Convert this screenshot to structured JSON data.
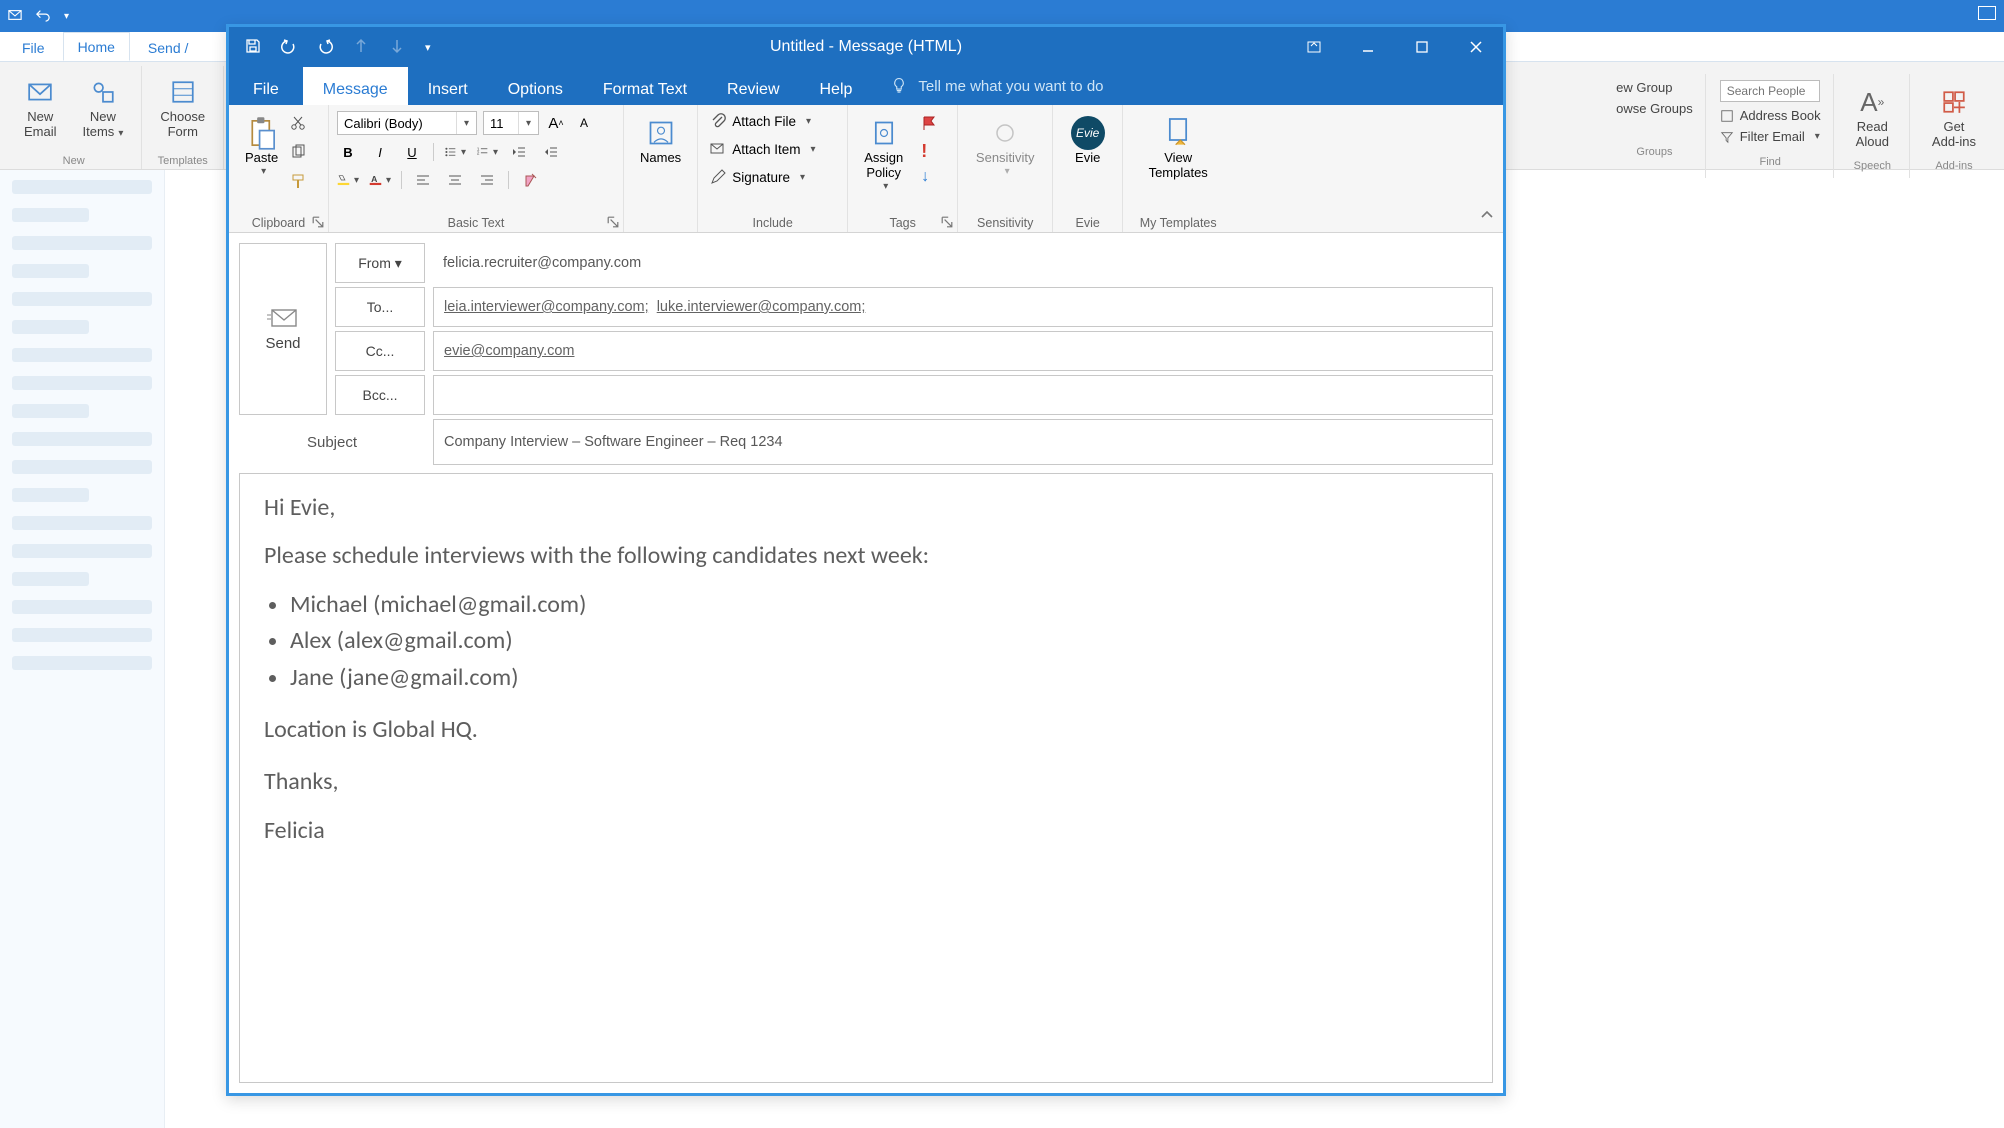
{
  "background": {
    "tabs": {
      "file": "File",
      "home": "Home",
      "send": "Send /"
    },
    "new_email": "New\nEmail",
    "new_items": "New\nItems",
    "choose_form": "Choose\nForm",
    "grp_new": "New",
    "grp_templates": "Templates",
    "right": {
      "new_group": "ew Group",
      "browse_groups": "owse Groups",
      "groups": "Groups",
      "search_placeholder": "Search People",
      "address_book": "Address Book",
      "filter_email": "Filter Email",
      "find": "Find",
      "read_aloud": "Read\nAloud",
      "speech": "Speech",
      "get_addins": "Get\nAdd-ins",
      "addins": "Add-ins"
    }
  },
  "compose": {
    "title": "Untitled  -  Message (HTML)",
    "tabs": {
      "file": "File",
      "message": "Message",
      "insert": "Insert",
      "options": "Options",
      "format": "Format Text",
      "review": "Review",
      "help": "Help",
      "tellme": "Tell me what you want to do"
    },
    "ribbon": {
      "paste": "Paste",
      "clipboard": "Clipboard",
      "font_name": "Calibri (Body)",
      "font_size": "11",
      "basic_text": "Basic Text",
      "names": "Names",
      "attach_file": "Attach File",
      "attach_item": "Attach Item",
      "signature": "Signature",
      "include": "Include",
      "assign_policy": "Assign\nPolicy",
      "tags": "Tags",
      "sensitivity": "Sensitivity",
      "sensitivity_grp": "Sensitivity",
      "evie": "Evie",
      "evie_grp": "Evie",
      "view_templates": "View\nTemplates",
      "my_templates": "My Templates"
    },
    "header": {
      "send": "Send",
      "from_btn": "From ▾",
      "from_val": "felicia.recruiter@company.com",
      "to_btn": "To...",
      "to_val1": "leia.interviewer@company.com;",
      "to_val2": "luke.interviewer@company.com;",
      "cc_btn": "Cc...",
      "cc_val": "evie@company.com",
      "bcc_btn": "Bcc...",
      "bcc_val": "",
      "subject_lbl": "Subject",
      "subject_val": "Company Interview – Software Engineer – Req 1234"
    },
    "body": {
      "greeting": "Hi Evie,",
      "intro": "Please schedule interviews with the following candidates next week:",
      "items": [
        "Michael (michael@gmail.com)",
        "Alex (alex@gmail.com)",
        "Jane (jane@gmail.com)"
      ],
      "location": "Location is Global HQ.",
      "thanks": "Thanks,",
      "sig": "Felicia"
    }
  }
}
